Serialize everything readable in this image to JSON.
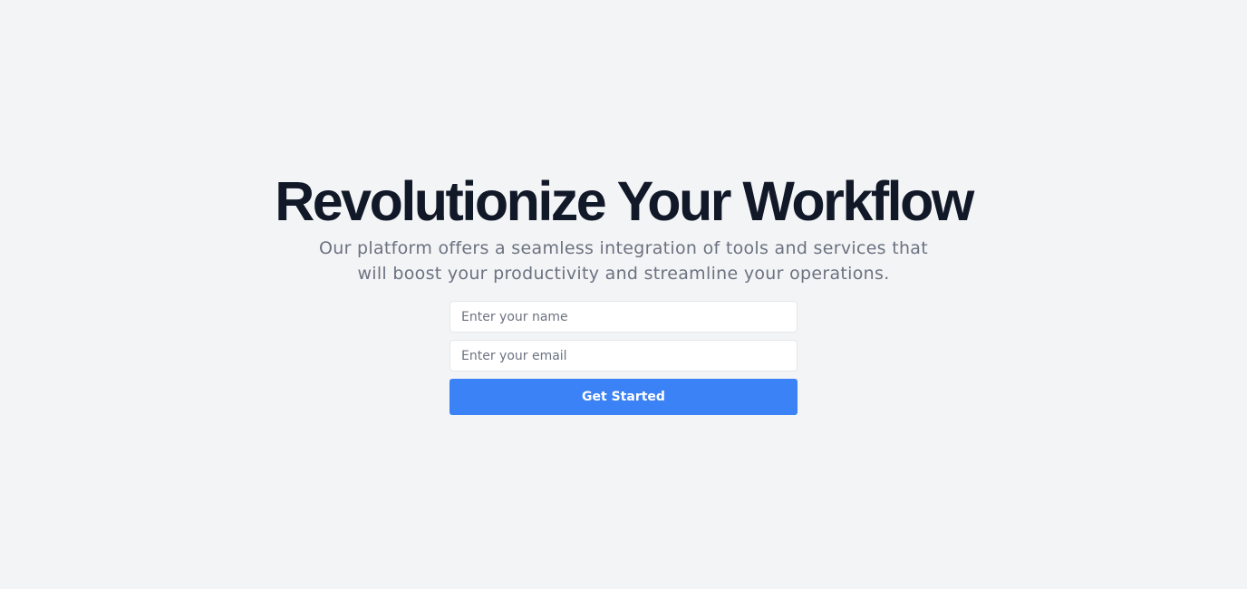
{
  "hero": {
    "title": "Revolutionize Your Workflow",
    "subtitle": "Our platform offers a seamless integration of tools and services that will boost your productivity and streamline your operations."
  },
  "form": {
    "name_placeholder": "Enter your name",
    "name_value": "",
    "email_placeholder": "Enter your email",
    "email_value": "",
    "submit_label": "Get Started"
  },
  "colors": {
    "background": "#f3f4f6",
    "heading": "#111827",
    "body_text": "#6b7280",
    "accent": "#3b82f6",
    "input_border": "#e5e7eb"
  }
}
